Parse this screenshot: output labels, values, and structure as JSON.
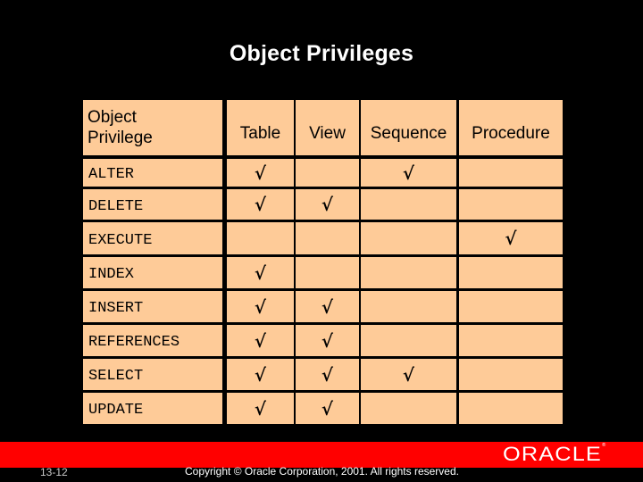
{
  "slide": {
    "title": "Object Privileges",
    "page_number": "13-12",
    "copyright": "Copyright © Oracle Corporation, 2001. All rights reserved.",
    "logo_text": "ORACLE",
    "colors": {
      "background": "#000000",
      "table_cell": "#fecb98",
      "footer_bar": "#ff0000",
      "title_text": "#ffffff"
    }
  },
  "table": {
    "headers": [
      "Object Privilege",
      "Table",
      "View",
      "Sequence",
      "Procedure"
    ],
    "header_first_lines": [
      "Object",
      "Privilege"
    ],
    "check_symbol": "√",
    "rows": [
      {
        "privilege": "ALTER",
        "cells": [
          "√",
          "",
          "√",
          ""
        ]
      },
      {
        "privilege": "DELETE",
        "cells": [
          "√",
          "√",
          "",
          ""
        ]
      },
      {
        "privilege": "EXECUTE",
        "cells": [
          "",
          "",
          "",
          "√"
        ]
      },
      {
        "privilege": "INDEX",
        "cells": [
          "√",
          "",
          "",
          ""
        ]
      },
      {
        "privilege": "INSERT",
        "cells": [
          "√",
          "√",
          "",
          ""
        ]
      },
      {
        "privilege": "REFERENCES",
        "cells": [
          "√",
          "√",
          "",
          ""
        ]
      },
      {
        "privilege": "SELECT",
        "cells": [
          "√",
          "√",
          "√",
          ""
        ]
      },
      {
        "privilege": "UPDATE",
        "cells": [
          "√",
          "√",
          "",
          ""
        ]
      }
    ]
  }
}
